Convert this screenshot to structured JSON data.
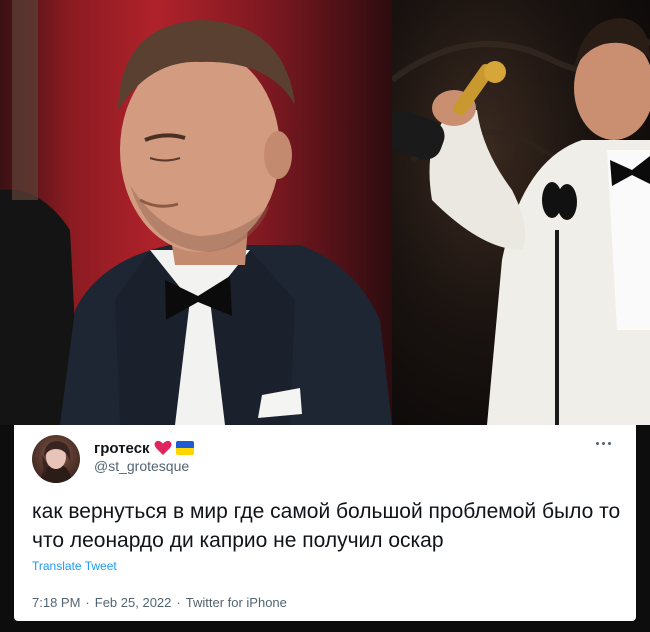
{
  "tweet": {
    "display_name": "гротеск",
    "handle": "@st_grotesque",
    "badges": [
      "heart-icon",
      "ukraine-flag-icon"
    ],
    "text": "как вернуться в мир где самой большой проблемой было то что леонардо ди каприо не получил оскар",
    "translate_label": "Translate Tweet",
    "time": "7:18 PM",
    "separator": "·",
    "date": "Feb 25, 2022",
    "source": "Twitter for iPhone",
    "more_icon": "more-horizontal-icon"
  },
  "colors": {
    "heart": "#e0245e",
    "flag_blue": "#1d5bd6",
    "flag_yellow": "#ffd500",
    "link": "#1d9bf0",
    "secondary_text": "#536471"
  }
}
